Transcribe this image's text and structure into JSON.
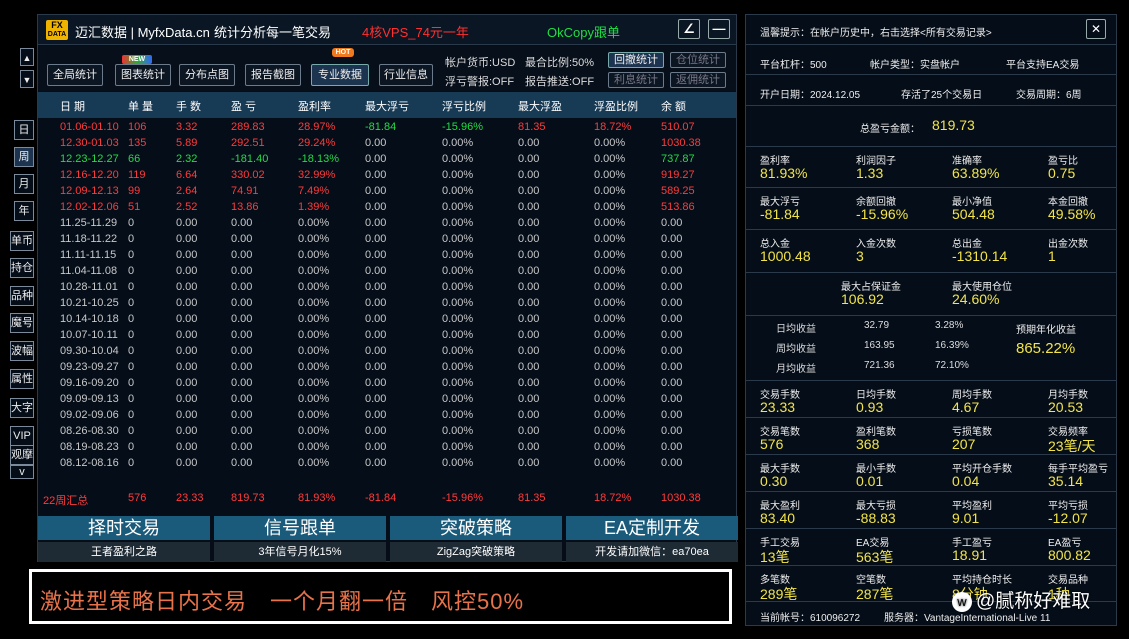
{
  "title": {
    "logo_top": "FX",
    "logo_bottom": "DATA",
    "app": "迈汇数据 | MyfxData.cn",
    "subtitle": "统计分析每一笔交易",
    "promo_red": "4核VPS_74元一年",
    "promo_green": "OkCopy跟单",
    "btn_edit": "∠",
    "btn_min": "—"
  },
  "toolbar": {
    "global": "全局统计",
    "chart": "图表统计",
    "scatter": "分布点图",
    "report": "报告截图",
    "pro": "专业数据",
    "industry": "行业信息",
    "badge_new": "NEW",
    "badge_hot": "HOT",
    "currency": "帐户货币:USD",
    "max_pos": "最合比例:50%",
    "drawdown_btn": "回撤统计",
    "position_btn": "仓位统计",
    "float_alarm": "浮亏警报:OFF",
    "report_push": "报告推送:OFF",
    "interest_btn": "利息统计",
    "rebate_btn": "返佣统计",
    "arrow_up": "▲",
    "arrow_down": "▼"
  },
  "sidebar": {
    "items": [
      "日",
      "周",
      "月",
      "年",
      "单币",
      "持仓",
      "品种",
      "魔号",
      "波幅",
      "属性",
      "大字",
      "VIP",
      "观摩"
    ],
    "chevron": "v"
  },
  "table": {
    "headers": [
      "日 期",
      "单 量",
      "手 数",
      "盈 亏",
      "盈利率",
      "最大浮亏",
      "浮亏比例",
      "最大浮盈",
      "浮盈比例",
      "余 额"
    ],
    "rows": [
      [
        "01.06-01.10",
        "106",
        "3.32",
        "289.83",
        "28.97%",
        "-81.84",
        "-15.96%",
        "81.35",
        "18.72%",
        "510.07"
      ],
      [
        "12.30-01.03",
        "135",
        "5.89",
        "292.51",
        "29.24%",
        "0.00",
        "0.00%",
        "0.00",
        "0.00%",
        "1030.38"
      ],
      [
        "12.23-12.27",
        "66",
        "2.32",
        "-181.40",
        "-18.13%",
        "0.00",
        "0.00%",
        "0.00",
        "0.00%",
        "737.87"
      ],
      [
        "12.16-12.20",
        "119",
        "6.64",
        "330.02",
        "32.99%",
        "0.00",
        "0.00%",
        "0.00",
        "0.00%",
        "919.27"
      ],
      [
        "12.09-12.13",
        "99",
        "2.64",
        "74.91",
        "7.49%",
        "0.00",
        "0.00%",
        "0.00",
        "0.00%",
        "589.25"
      ],
      [
        "12.02-12.06",
        "51",
        "2.52",
        "13.86",
        "1.39%",
        "0.00",
        "0.00%",
        "0.00",
        "0.00%",
        "513.86"
      ],
      [
        "11.25-11.29",
        "0",
        "0.00",
        "0.00",
        "0.00%",
        "0.00",
        "0.00%",
        "0.00",
        "0.00%",
        "0.00"
      ],
      [
        "11.18-11.22",
        "0",
        "0.00",
        "0.00",
        "0.00%",
        "0.00",
        "0.00%",
        "0.00",
        "0.00%",
        "0.00"
      ],
      [
        "11.11-11.15",
        "0",
        "0.00",
        "0.00",
        "0.00%",
        "0.00",
        "0.00%",
        "0.00",
        "0.00%",
        "0.00"
      ],
      [
        "11.04-11.08",
        "0",
        "0.00",
        "0.00",
        "0.00%",
        "0.00",
        "0.00%",
        "0.00",
        "0.00%",
        "0.00"
      ],
      [
        "10.28-11.01",
        "0",
        "0.00",
        "0.00",
        "0.00%",
        "0.00",
        "0.00%",
        "0.00",
        "0.00%",
        "0.00"
      ],
      [
        "10.21-10.25",
        "0",
        "0.00",
        "0.00",
        "0.00%",
        "0.00",
        "0.00%",
        "0.00",
        "0.00%",
        "0.00"
      ],
      [
        "10.14-10.18",
        "0",
        "0.00",
        "0.00",
        "0.00%",
        "0.00",
        "0.00%",
        "0.00",
        "0.00%",
        "0.00"
      ],
      [
        "10.07-10.11",
        "0",
        "0.00",
        "0.00",
        "0.00%",
        "0.00",
        "0.00%",
        "0.00",
        "0.00%",
        "0.00"
      ],
      [
        "09.30-10.04",
        "0",
        "0.00",
        "0.00",
        "0.00%",
        "0.00",
        "0.00%",
        "0.00",
        "0.00%",
        "0.00"
      ],
      [
        "09.23-09.27",
        "0",
        "0.00",
        "0.00",
        "0.00%",
        "0.00",
        "0.00%",
        "0.00",
        "0.00%",
        "0.00"
      ],
      [
        "09.16-09.20",
        "0",
        "0.00",
        "0.00",
        "0.00%",
        "0.00",
        "0.00%",
        "0.00",
        "0.00%",
        "0.00"
      ],
      [
        "09.09-09.13",
        "0",
        "0.00",
        "0.00",
        "0.00%",
        "0.00",
        "0.00%",
        "0.00",
        "0.00%",
        "0.00"
      ],
      [
        "09.02-09.06",
        "0",
        "0.00",
        "0.00",
        "0.00%",
        "0.00",
        "0.00%",
        "0.00",
        "0.00%",
        "0.00"
      ],
      [
        "08.26-08.30",
        "0",
        "0.00",
        "0.00",
        "0.00%",
        "0.00",
        "0.00%",
        "0.00",
        "0.00%",
        "0.00"
      ],
      [
        "08.19-08.23",
        "0",
        "0.00",
        "0.00",
        "0.00%",
        "0.00",
        "0.00%",
        "0.00",
        "0.00%",
        "0.00"
      ],
      [
        "08.12-08.16",
        "0",
        "0.00",
        "0.00",
        "0.00%",
        "0.00",
        "0.00%",
        "0.00",
        "0.00%",
        "0.00"
      ]
    ],
    "summary": [
      "22周汇总",
      "576",
      "23.33",
      "819.73",
      "81.93%",
      "-81.84",
      "-15.96%",
      "81.35",
      "18.72%",
      "1030.38"
    ]
  },
  "promos": [
    {
      "title": "择时交易",
      "sub": "王者盈利之路"
    },
    {
      "title": "信号跟单",
      "sub": "3年信号月化15%"
    },
    {
      "title": "突破策略",
      "sub": "ZigZag突破策略"
    },
    {
      "title": "EA定制开发",
      "sub": "开发请加微信：ea70ea"
    }
  ],
  "banner": "激进型策略日内交易　一个月翻一倍　风控50%",
  "right": {
    "tip": "温馨提示：在帐户历史中，右击选择<所有交易记录>",
    "close": "✕",
    "leverage": "平台杠杆：500",
    "acct_type": "帐户类型：实盘帐户",
    "ea_support": "平台支持EA交易",
    "open_date": "开户日期：2024.12.05",
    "stored": "存活了25个交易日",
    "cycle": "交易周期：6周",
    "total_label": "总盈亏金额：",
    "total_value": "819.73",
    "g1": [
      {
        "l": "盈利率",
        "v": "81.93%"
      },
      {
        "l": "利润因子",
        "v": "1.33"
      },
      {
        "l": "准确率",
        "v": "63.89%"
      },
      {
        "l": "盈亏比",
        "v": "0.75"
      }
    ],
    "g2": [
      {
        "l": "最大浮亏",
        "v": "-81.84"
      },
      {
        "l": "余额回撤",
        "v": "-15.96%"
      },
      {
        "l": "最小净值",
        "v": "504.48"
      },
      {
        "l": "本金回撤",
        "v": "49.58%"
      }
    ],
    "g3": [
      {
        "l": "总入金",
        "v": "1000.48"
      },
      {
        "l": "入金次数",
        "v": "3"
      },
      {
        "l": "总出金",
        "v": "-1310.14"
      },
      {
        "l": "出金次数",
        "v": "1"
      }
    ],
    "g4": [
      {
        "l": "最大占保证金",
        "v": "106.92"
      },
      {
        "l": "最大使用仓位",
        "v": "24.60%"
      }
    ],
    "avg": [
      {
        "l": "日均收益",
        "a": "32.79",
        "b": "3.28%"
      },
      {
        "l": "周均收益",
        "a": "163.95",
        "b": "16.39%"
      },
      {
        "l": "月均收益",
        "a": "721.36",
        "b": "72.10%"
      }
    ],
    "annual_label": "预期年化收益",
    "annual_value": "865.22%",
    "g5": [
      {
        "l": "交易手数",
        "v": "23.33"
      },
      {
        "l": "日均手数",
        "v": "0.93"
      },
      {
        "l": "周均手数",
        "v": "4.67"
      },
      {
        "l": "月均手数",
        "v": "20.53"
      }
    ],
    "g6": [
      {
        "l": "交易笔数",
        "v": "576"
      },
      {
        "l": "盈利笔数",
        "v": "368"
      },
      {
        "l": "亏损笔数",
        "v": "207"
      },
      {
        "l": "交易频率",
        "v": "23笔/天"
      }
    ],
    "g7": [
      {
        "l": "最大手数",
        "v": "0.30"
      },
      {
        "l": "最小手数",
        "v": "0.01"
      },
      {
        "l": "平均开仓手数",
        "v": "0.04"
      },
      {
        "l": "每手平均盈亏",
        "v": "35.14"
      }
    ],
    "g8": [
      {
        "l": "最大盈利",
        "v": "83.40"
      },
      {
        "l": "最大亏损",
        "v": "-88.83"
      },
      {
        "l": "平均盈利",
        "v": "9.01"
      },
      {
        "l": "平均亏损",
        "v": "-12.07"
      }
    ],
    "g9": [
      {
        "l": "手工交易",
        "v": "13笔"
      },
      {
        "l": "EA交易",
        "v": "563笔"
      },
      {
        "l": "手工盈亏",
        "v": "18.91"
      },
      {
        "l": "EA盈亏",
        "v": "800.82"
      }
    ],
    "g10": [
      {
        "l": "多笔数",
        "v": "289笔"
      },
      {
        "l": "空笔数",
        "v": "287笔"
      },
      {
        "l": "平均持仓时长",
        "v": "8分钟"
      },
      {
        "l": "交易品种",
        "v": "1种"
      }
    ],
    "account": "当前帐号：610096272",
    "server": "服务器：VantageInternational-Live 11"
  },
  "watermark": "@腻称好难取"
}
